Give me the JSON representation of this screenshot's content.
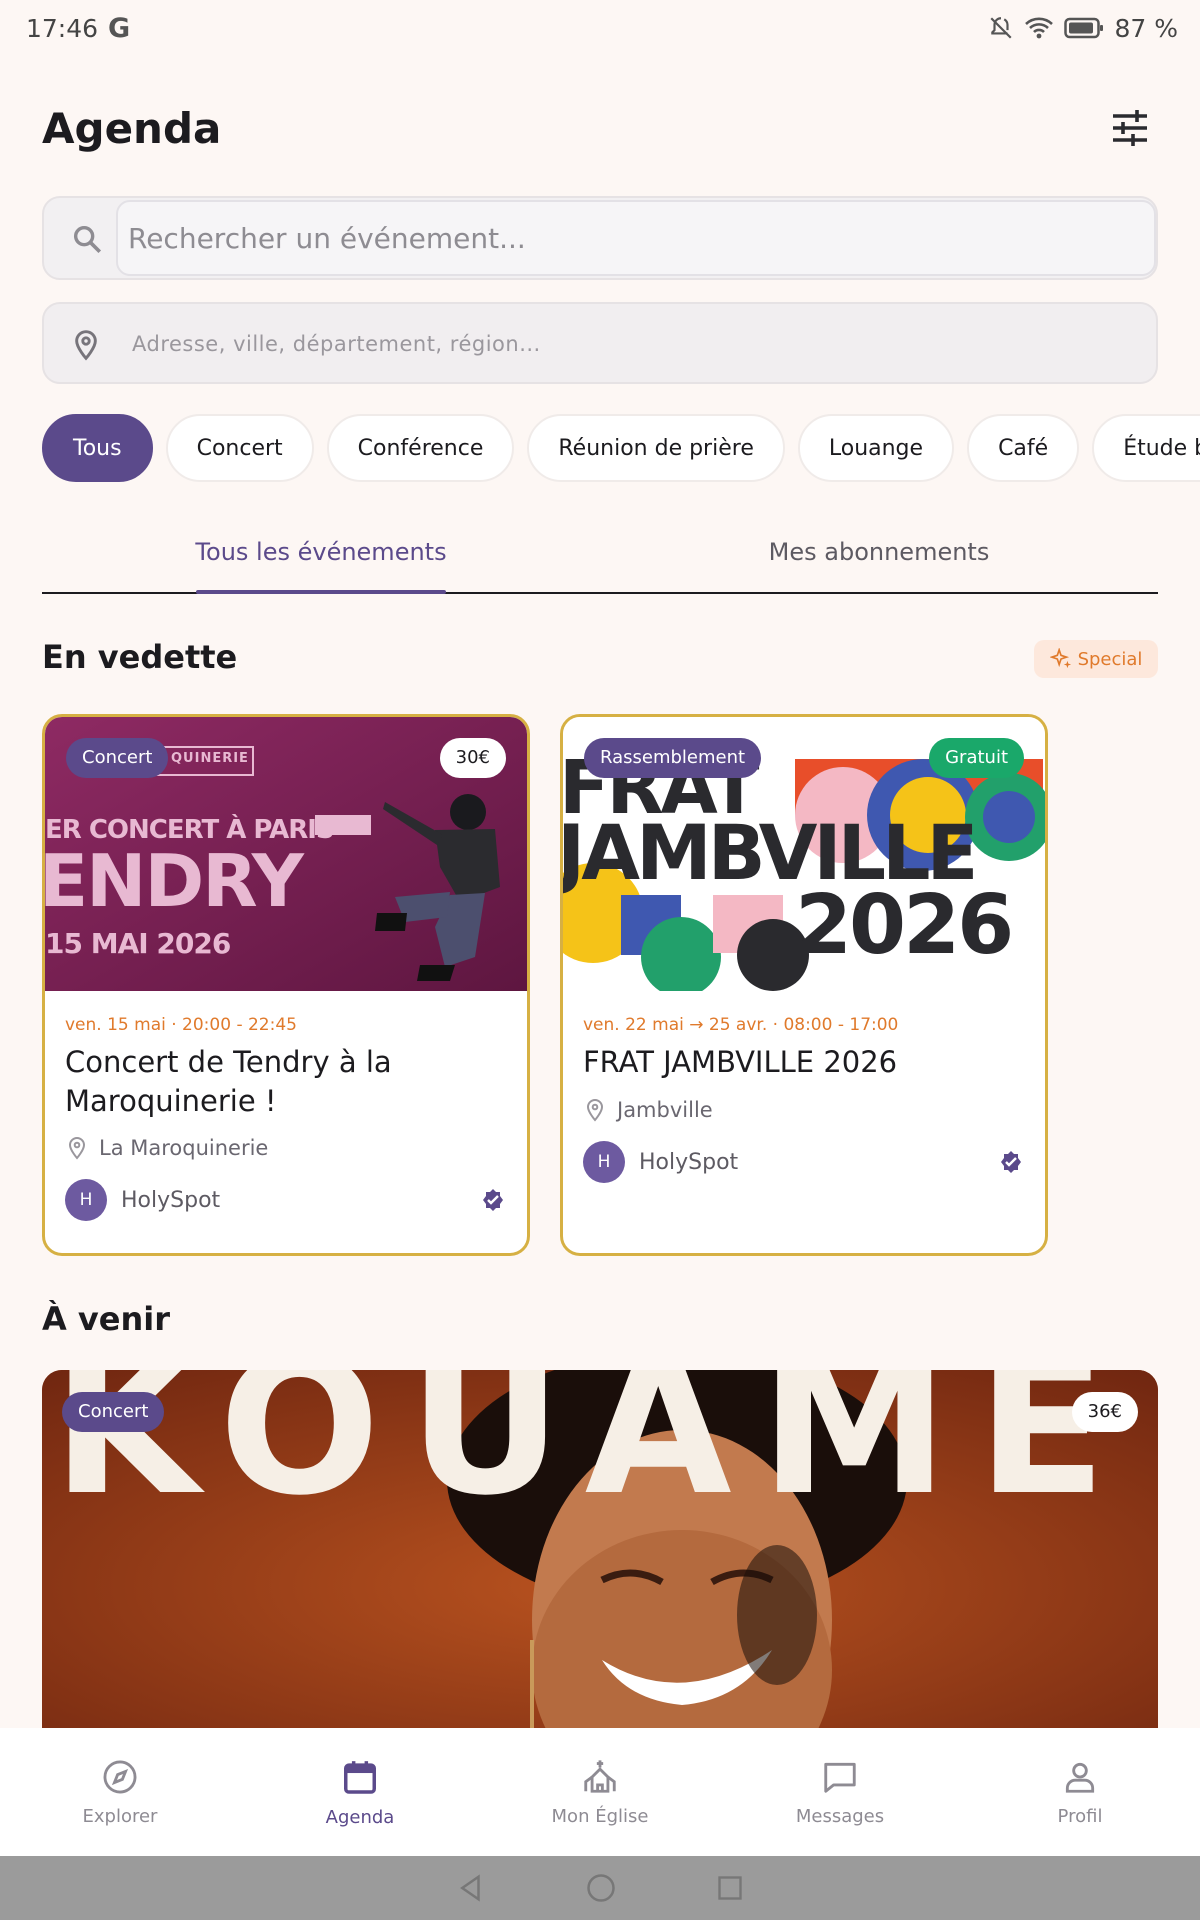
{
  "status_bar": {
    "time": "17:46",
    "g_label": "G",
    "battery": "87 %"
  },
  "header": {
    "title": "Agenda",
    "filter_icon": "tune-icon"
  },
  "search": {
    "placeholder": "Rechercher un événement...",
    "location_placeholder": "Adresse, ville, département, région..."
  },
  "chips": [
    "Tous",
    "Concert",
    "Conférence",
    "Réunion de prière",
    "Louange",
    "Café",
    "Étude biblique"
  ],
  "tabs": {
    "all": "Tous les événements",
    "subs": "Mes abonnements"
  },
  "featured": {
    "title": "En vedette",
    "badge": "Special",
    "cards": [
      {
        "category": "Concert",
        "price": "30€",
        "date": "ven. 15 mai · 20:00 - 22:45",
        "title": "Concert de Tendry à la Maroquinerie !",
        "place": "La Maroquinerie",
        "org_initial": "H",
        "org": "HolySpot",
        "poster": {
          "top": "ER CONCERT À PARIS",
          "big": "ENDRY",
          "date": "15 MAI 2026",
          "brand": "QUINERIE"
        }
      },
      {
        "category": "Rassemblement",
        "price": "Gratuit",
        "date": "ven. 22 mai → 25 avr. · 08:00 - 17:00",
        "title": "FRAT JAMBVILLE 2026",
        "place": "Jambville",
        "org_initial": "H",
        "org": "HolySpot",
        "poster": {
          "line1": "FRAT",
          "line2": "JAMBVILLE",
          "line3": "2026"
        }
      }
    ]
  },
  "upcoming": {
    "title": "À venir",
    "card": {
      "category": "Concert",
      "price": "36€",
      "poster_text": "KOUAMÉ"
    }
  },
  "bottom_nav": [
    {
      "label": "Explorer",
      "icon": "compass-icon"
    },
    {
      "label": "Agenda",
      "icon": "calendar-icon"
    },
    {
      "label": "Mon Église",
      "icon": "church-icon"
    },
    {
      "label": "Messages",
      "icon": "message-icon"
    },
    {
      "label": "Profil",
      "icon": "person-icon"
    }
  ],
  "colors": {
    "accent": "#5b4a8b",
    "orange": "#e07a2c",
    "gold_border": "#d6b043",
    "free_green": "#1aa86a"
  }
}
